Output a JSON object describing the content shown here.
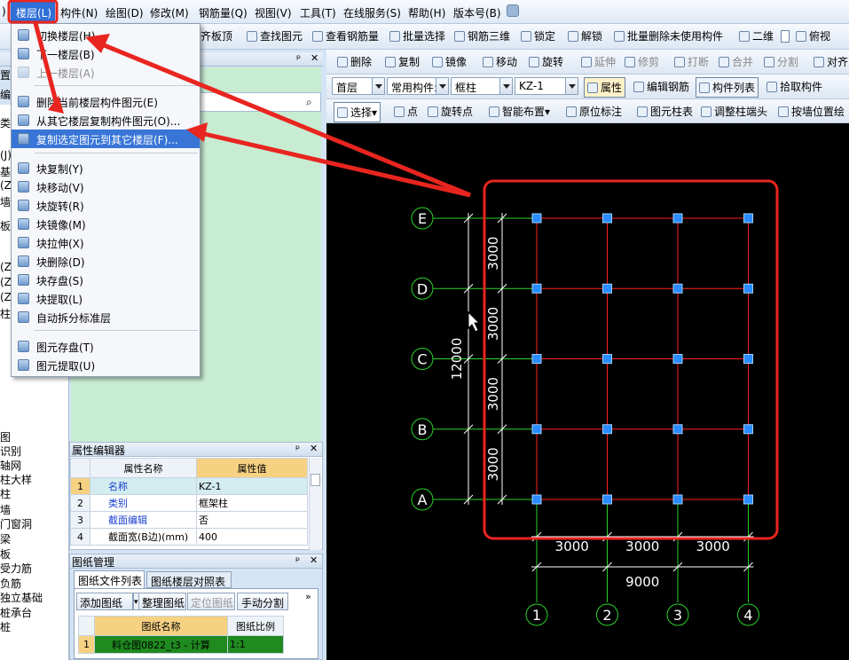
{
  "menubar": {
    "items": [
      {
        "label": ")"
      },
      {
        "label": "楼层(L)"
      },
      {
        "label": "构件(N)"
      },
      {
        "label": "绘图(D)"
      },
      {
        "label": "修改(M)"
      },
      {
        "label": "钢筋量(Q)"
      },
      {
        "label": "视图(V)"
      },
      {
        "label": "工具(T)"
      },
      {
        "label": "在线服务(S)"
      },
      {
        "label": "帮助(H)"
      },
      {
        "label": "版本号(B)"
      }
    ]
  },
  "toolbar1": {
    "items": [
      "齐板顶",
      "查找图元",
      "查看钢筋量",
      "批量选择",
      "钢筋三维",
      "锁定",
      "解锁",
      "批量删除未使用构件"
    ],
    "view2d": "二维",
    "view_mode": "俯视"
  },
  "toolbar2": {
    "items": [
      "删除",
      "复制",
      "镜像",
      "移动",
      "旋转",
      "延伸",
      "修剪",
      "打断",
      "合并",
      "分割",
      "对齐"
    ]
  },
  "toolbar3": {
    "floor": "首层",
    "category": "常用构件:",
    "type": "框柱",
    "component": "KZ-1",
    "buttons": [
      "属性",
      "编辑钢筋",
      "构件列表",
      "拾取构件"
    ]
  },
  "toolbar4": {
    "items": [
      "选择",
      "点",
      "旋转点",
      "智能布置",
      "原位标注",
      "图元柱表",
      "调整柱端头",
      "按墙位置绘"
    ]
  },
  "dropdown": {
    "items": [
      {
        "label": "切换楼层(H)",
        "disabled": false
      },
      {
        "label": "下一楼层(B)",
        "disabled": false
      },
      {
        "label": "上一楼层(A)",
        "disabled": true
      },
      {
        "label": "删除当前楼层构件图元(E)",
        "disabled": false
      },
      {
        "label": "从其它楼层复制构件图元(O)...",
        "disabled": false
      },
      {
        "label": "复制选定图元到其它楼层(F)...",
        "disabled": false,
        "highlight": true
      },
      {
        "label": "块复制(Y)",
        "disabled": false
      },
      {
        "label": "块移动(V)",
        "disabled": false
      },
      {
        "label": "块旋转(R)",
        "disabled": false
      },
      {
        "label": "块镜像(M)",
        "disabled": false
      },
      {
        "label": "块拉伸(X)",
        "disabled": false
      },
      {
        "label": "块删除(D)",
        "disabled": false
      },
      {
        "label": "块存盘(S)",
        "disabled": false
      },
      {
        "label": "块提取(L)",
        "disabled": false
      },
      {
        "label": "自动拆分标准层",
        "disabled": false
      },
      {
        "label": "图元存盘(T)",
        "disabled": false
      },
      {
        "label": "图元提取(U)",
        "disabled": false
      }
    ]
  },
  "leftpanel": {
    "fragments": [
      "置",
      "编入",
      "类",
      "(J)",
      "基础",
      "(Z)",
      "墙",
      "板",
      "(Z)",
      "(Z)",
      "(Z)",
      "柱"
    ],
    "tree": [
      "图",
      "识别",
      "轴网",
      "柱大样",
      "柱",
      "墙",
      "门窗洞",
      "梁",
      "板",
      "受力筋",
      "负筋",
      "独立基础",
      "桩承台",
      "桩"
    ]
  },
  "props": {
    "title": "属性编辑器",
    "header": [
      "属性名称",
      "属性值"
    ],
    "rows": [
      {
        "idx": "1",
        "name": "名称",
        "value": "KZ-1"
      },
      {
        "idx": "2",
        "name": "类别",
        "value": "框架柱"
      },
      {
        "idx": "3",
        "name": "截面编辑",
        "value": "否"
      },
      {
        "idx": "4",
        "name": "截面宽(B边)(mm)",
        "value": "400"
      }
    ]
  },
  "drawing_mgr": {
    "title": "图纸管理",
    "tabs": [
      "图纸文件列表",
      "图纸楼层对照表"
    ],
    "buttons": [
      "添加图纸",
      "整理图纸",
      "定位图纸",
      "手动分割"
    ],
    "header": [
      "图纸名称",
      "图纸比例"
    ],
    "rows": [
      {
        "idx": "1",
        "name": "料仓图0822_t3 - 计算",
        "scale": "1:1"
      }
    ]
  },
  "canvas": {
    "row_axes": [
      "E",
      "D",
      "C",
      "B",
      "A"
    ],
    "col_axes": [
      "1",
      "2",
      "3",
      "4"
    ],
    "row_dims": [
      "3000",
      "3000",
      "3000",
      "3000"
    ],
    "total_row_dim": "12000",
    "col_dims": [
      "3000",
      "3000",
      "3000"
    ],
    "total_col_dim": "9000"
  },
  "colors": {
    "accent": "#3875d7",
    "grid_red": "#ff2020",
    "axis_green": "#2bd12b",
    "dim_white": "#ffffff",
    "column_blue": "#2a8cff",
    "annotation_red": "#e8251f"
  }
}
